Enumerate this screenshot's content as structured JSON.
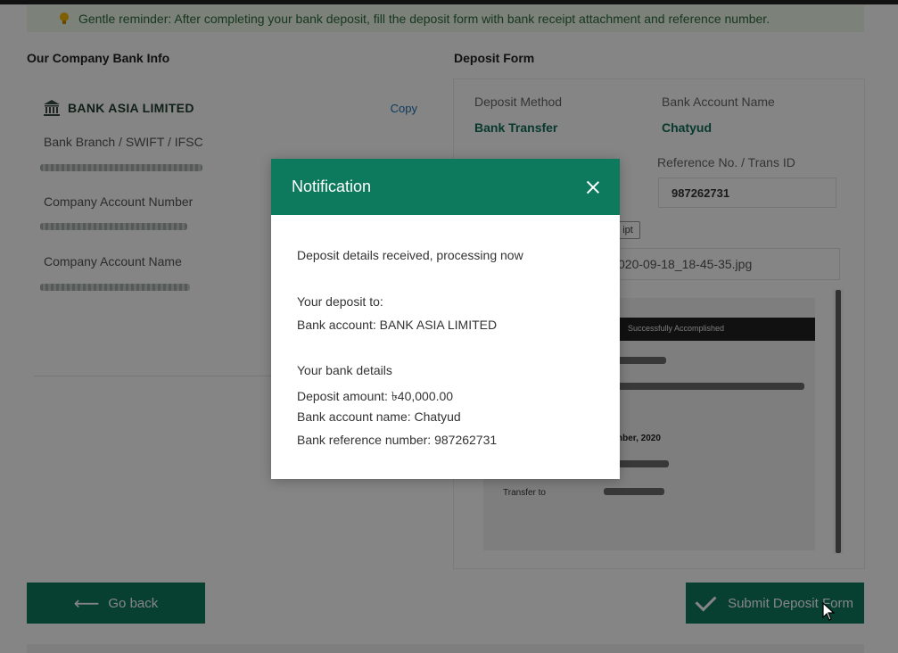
{
  "reminder": {
    "text": "Gentle reminder: After completing your bank deposit, fill the deposit form with bank receipt attachment and reference number.",
    "icon": "lightbulb-icon"
  },
  "company_bank": {
    "title": "Our Company Bank Info",
    "bank_name": "BANK ASIA LIMITED",
    "copy_label": "Copy",
    "branch_label": "Bank Branch / SWIFT / IFSC",
    "account_number_label": "Company Account Number",
    "account_name_label": "Company Account Name"
  },
  "deposit_form": {
    "title": "Deposit Form",
    "method_label": "Deposit Method",
    "method_value": "Bank Transfer",
    "account_name_label": "Bank Account Name",
    "account_name_value": "Chatyud",
    "reference_label": "Reference No. / Trans ID",
    "reference_value": "987262731",
    "receipt_tag": "ipt",
    "file_name": "020-09-18_18-45-35.jpg",
    "receipt_preview": {
      "header": "Successfully Accomplished",
      "date_text": "nber, 2020",
      "transfer_label": "Transfer to"
    }
  },
  "buttons": {
    "go_back": "Go back",
    "submit": "Submit Deposit Form"
  },
  "notification": {
    "title": "Notification",
    "message": "Deposit details received, processing now",
    "deposit_to_heading": "Your deposit to:",
    "bank_account_line": "Bank account: BANK ASIA LIMITED",
    "bank_details_heading": "Your bank details",
    "deposit_amount_line": "Deposit amount: ৳40,000.00",
    "account_name_line": "Bank account name: Chatyud",
    "reference_line": "Bank reference number: 987262731"
  },
  "colors": {
    "brand_green": "#0d7a5e",
    "reminder_bg": "#eef7e9",
    "link_blue": "#1a6fb3"
  }
}
